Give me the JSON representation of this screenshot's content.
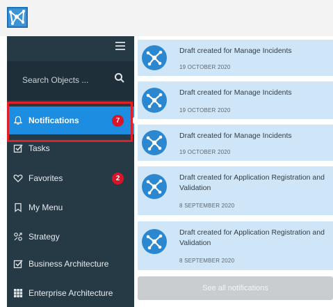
{
  "app": {
    "logo_icon": "mesh-logo-icon",
    "brand_color": "#1c8de0"
  },
  "sidebar": {
    "menu_icon": "hamburger-icon",
    "search": {
      "placeholder": "Search Objects ...",
      "icon": "search-icon"
    },
    "items": [
      {
        "label": "Notifications",
        "icon": "bell-icon",
        "badge": "7",
        "active": true
      },
      {
        "label": "Tasks",
        "icon": "checkbox-icon"
      },
      {
        "label": "Favorites",
        "icon": "heart-icon",
        "badge": "2"
      },
      {
        "label": "My Menu",
        "icon": "bookmark-icon"
      },
      {
        "label": "Strategy",
        "icon": "strategy-icon"
      },
      {
        "label": "Business Architecture",
        "icon": "checkbox-icon"
      },
      {
        "label": "Enterprise Architecture",
        "icon": "grid-icon"
      }
    ]
  },
  "notifications": {
    "items": [
      {
        "text": "Draft created for Manage Incidents",
        "date": "19 OCTOBER 2020"
      },
      {
        "text": "Draft created for Manage Incidents",
        "date": "19 OCTOBER 2020"
      },
      {
        "text": "Draft created for Manage Incidents",
        "date": "19 OCTOBER 2020"
      },
      {
        "text": "Draft created for Application Registration and Validation",
        "date": "8 SEPTEMBER 2020"
      },
      {
        "text": "Draft created for Application Registration and Validation",
        "date": "8 SEPTEMBER 2020"
      }
    ],
    "see_all_label": "See all notifications"
  }
}
